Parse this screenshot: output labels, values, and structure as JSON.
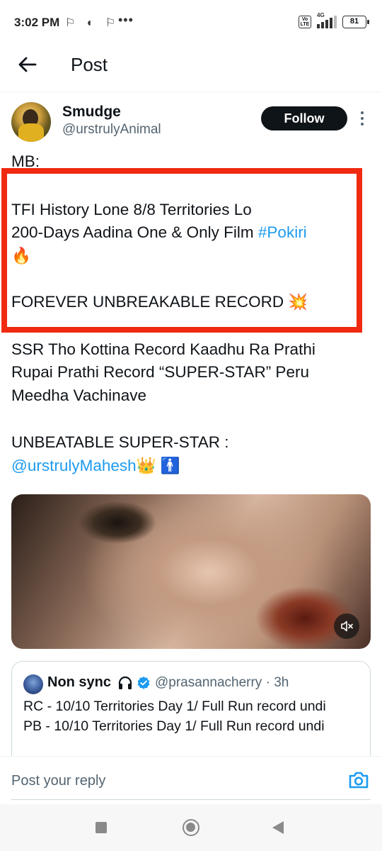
{
  "status_bar": {
    "time": "3:02 PM",
    "left_icons": "⚐ ◐ ⚐",
    "overflow": "•••",
    "network_label": "4G",
    "volte_label": "Vo LTE",
    "battery": "81"
  },
  "header": {
    "back_icon": "arrow-left-icon",
    "title": "Post"
  },
  "author": {
    "name": "Smudge",
    "handle": "@urstrulyAnimal",
    "follow_label": "Follow"
  },
  "post": {
    "line1": "MB:",
    "line2": "TFI History Lone 8/8 Territories Lo",
    "line3_text": "200-Days Aadina One & Only Film ",
    "line3_hashtag": "#Pokiri",
    "line4": "🔥",
    "line5": "FOREVER UNBREAKABLE RECORD 💥",
    "line6": "SSR Tho Kottina Record Kaadhu Ra Prathi",
    "line7": "Rupai Prathi Record “SUPER-STAR” Peru",
    "line8": "Meedha Vachinave",
    "line9": "UNBEATABLE SUPER-STAR :",
    "line10_mention": "@urstrulyMahesh",
    "line10_emoji": "👑 🚹"
  },
  "media": {
    "mute_icon": "volume-muted-icon"
  },
  "quote": {
    "name": "Non sync",
    "handle_time": "@prasannacherry · 3h",
    "line1": "RC - 10/10 Territories Day 1/ Full Run record undi",
    "line2": "PB - 10/10 Territories Day 1/ Full Run record undi"
  },
  "reply": {
    "placeholder": "Post your reply"
  },
  "colors": {
    "accent": "#1d9bf0",
    "highlight": "#f02a10",
    "text": "#0f1419",
    "secondary": "#536471"
  }
}
